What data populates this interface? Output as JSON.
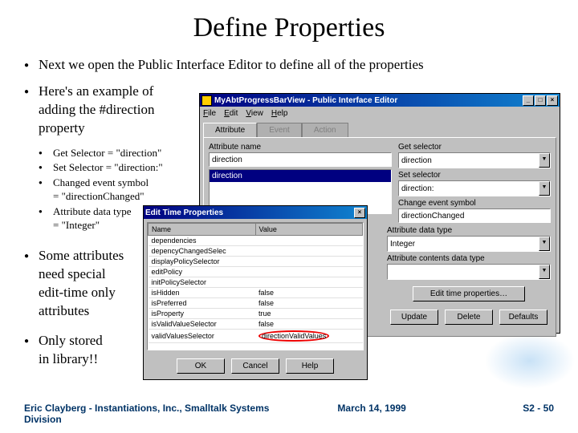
{
  "title": "Define Properties",
  "bullets": {
    "b1": "Next we open the Public Interface Editor to define all of the properties",
    "b2_l1": "Here's an example of",
    "b2_l2": "adding the #direction",
    "b2_l3": "property",
    "sub": [
      "Get Selector = \"direction\"",
      "Set Selector = \"direction:\"",
      "Changed event symbol",
      "= \"directionChanged\"",
      "Attribute data type",
      "= \"Integer\""
    ],
    "b3_l1": "Some attributes",
    "b3_l2": "need special",
    "b3_l3": "edit-time only",
    "b3_l4": "attributes",
    "b4_l1": "Only stored",
    "b4_l2": "in library!!"
  },
  "win1": {
    "title": "MyAbtProgressBarView - Public Interface Editor",
    "menu": {
      "file": "File",
      "edit": "Edit",
      "view": "View",
      "help": "Help"
    },
    "tabs": {
      "attribute": "Attribute",
      "event": "Event",
      "action": "Action"
    },
    "labels": {
      "attr_name": "Attribute name",
      "get_sel": "Get selector",
      "set_sel": "Set selector",
      "change_evt": "Change event symbol",
      "attr_type": "Attribute data type",
      "contents_type": "Attribute contents data type"
    },
    "values": {
      "attr_name": "direction",
      "list_sel": "direction",
      "get_sel": "direction",
      "set_sel": "direction:",
      "change_evt": "directionChanged",
      "attr_type": "Integer",
      "contents_type": ""
    },
    "buttons": {
      "edit_time": "Edit time properties…",
      "update": "Update",
      "delete": "Delete",
      "defaults": "Defaults"
    }
  },
  "win2": {
    "title": "Edit Time Properties",
    "headers": {
      "name": "Name",
      "value": "Value"
    },
    "rows": [
      {
        "name": "dependencies",
        "value": ""
      },
      {
        "name": "depencyChangedSelec",
        "value": ""
      },
      {
        "name": "displayPolicySelector",
        "value": ""
      },
      {
        "name": "editPolicy",
        "value": ""
      },
      {
        "name": "initPolicySelector",
        "value": ""
      },
      {
        "name": "isHidden",
        "value": "false"
      },
      {
        "name": "isPreferred",
        "value": "false"
      },
      {
        "name": "isProperty",
        "value": "true"
      },
      {
        "name": "isValidValueSelector",
        "value": "false"
      },
      {
        "name": "validValuesSelector",
        "value": "directionValidValues"
      }
    ],
    "buttons": {
      "ok": "OK",
      "cancel": "Cancel",
      "help": "Help"
    }
  },
  "footer": {
    "author": "Eric Clayberg - Instantiations, Inc., Smalltalk Systems Division",
    "date": "March 14, 1999",
    "page": "S2 - 50"
  }
}
